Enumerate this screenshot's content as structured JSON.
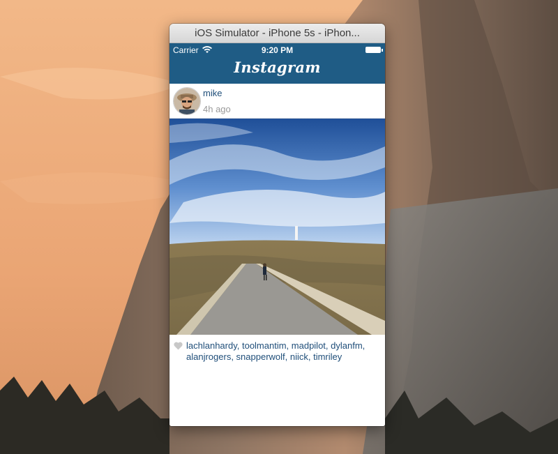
{
  "window": {
    "title": "iOS Simulator - iPhone 5s - iPhon..."
  },
  "status_bar": {
    "carrier": "Carrier",
    "time": "9:20 PM"
  },
  "app": {
    "title": "Instagram",
    "nav_color": "#1f5c85"
  },
  "post": {
    "username": "mike",
    "timestamp": "4h ago",
    "likes_text": "lachlanhardy, toolmantim, madpilot, dylanfm, alanjrogers, snapperwolf, niick, timriley"
  },
  "icons": [
    "wifi-icon",
    "battery-icon",
    "heart-icon",
    "avatar"
  ]
}
